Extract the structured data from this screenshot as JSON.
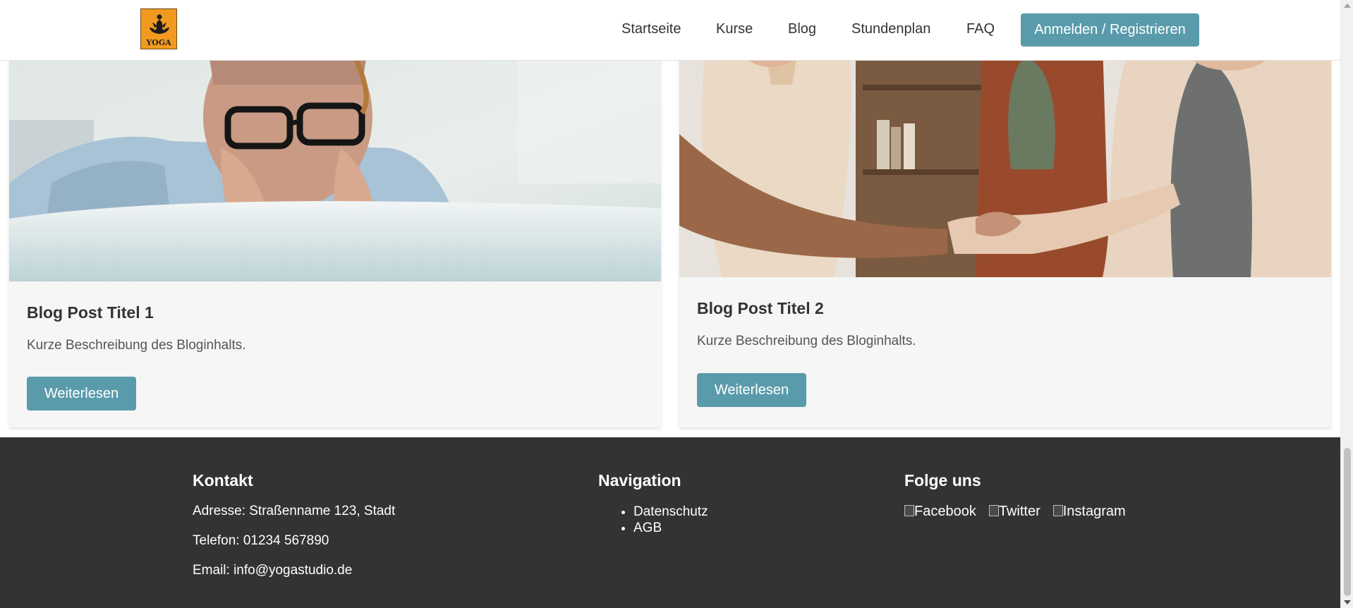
{
  "header": {
    "logo_text": "YOGA",
    "nav": [
      {
        "label": "Startseite"
      },
      {
        "label": "Kurse"
      },
      {
        "label": "Blog"
      },
      {
        "label": "Stundenplan"
      },
      {
        "label": "FAQ"
      }
    ],
    "cta_label": "Anmelden / Registrieren"
  },
  "posts": [
    {
      "title": "Blog Post Titel 1",
      "description": "Kurze Beschreibung des Bloginhalts.",
      "button_label": "Weiterlesen"
    },
    {
      "title": "Blog Post Titel 2",
      "description": "Kurze Beschreibung des Bloginhalts.",
      "button_label": "Weiterlesen"
    }
  ],
  "footer": {
    "contact": {
      "heading": "Kontakt",
      "address": "Adresse: Straßenname 123, Stadt",
      "phone": "Telefon: 01234 567890",
      "email": "Email: info@yogastudio.de"
    },
    "navigation": {
      "heading": "Navigation",
      "links": [
        "Datenschutz",
        "AGB"
      ]
    },
    "social": {
      "heading": "Folge uns",
      "links": [
        "Facebook",
        "Twitter",
        "Instagram"
      ]
    }
  },
  "colors": {
    "accent": "#5a9bab",
    "footer_bg": "#333333",
    "card_bg": "#f6f6f6",
    "logo_bg": "#f29a1f"
  },
  "icons": {
    "logo": "yoga-lotus-icon",
    "social_placeholder": "broken-image-icon"
  }
}
